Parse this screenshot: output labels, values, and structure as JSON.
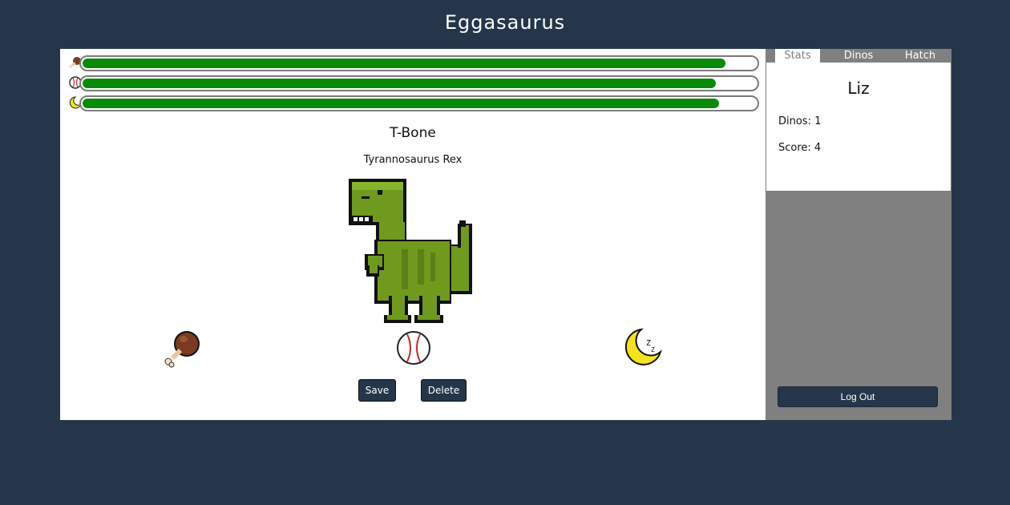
{
  "app": {
    "title": "Eggasaurus"
  },
  "stats_bars": [
    {
      "icon": "drumstick-icon",
      "level": 0.955
    },
    {
      "icon": "baseball-icon",
      "level": 0.94
    },
    {
      "icon": "moon-icon",
      "level": 0.945
    }
  ],
  "dino": {
    "name": "T-Bone",
    "species": "Tyrannosaurus Rex"
  },
  "actions": {
    "feed_icon": "drumstick-icon",
    "play_icon": "baseball-icon",
    "sleep_icon": "moon-icon"
  },
  "buttons": {
    "save": "Save",
    "delete": "Delete"
  },
  "sidebar": {
    "tabs": [
      {
        "label": "Stats",
        "active": true
      },
      {
        "label": "Dinos",
        "active": false
      },
      {
        "label": "Hatch",
        "active": false
      }
    ],
    "user_name": "Liz",
    "dinos_line": "Dinos: 1",
    "score_line": "Score: 4",
    "logout": "Log Out"
  },
  "colors": {
    "background": "#25364a",
    "bar_fill": "#0a8a0a",
    "dino_green": "#6f9a1e",
    "button": "#25364a",
    "sidebar": "#808080"
  }
}
